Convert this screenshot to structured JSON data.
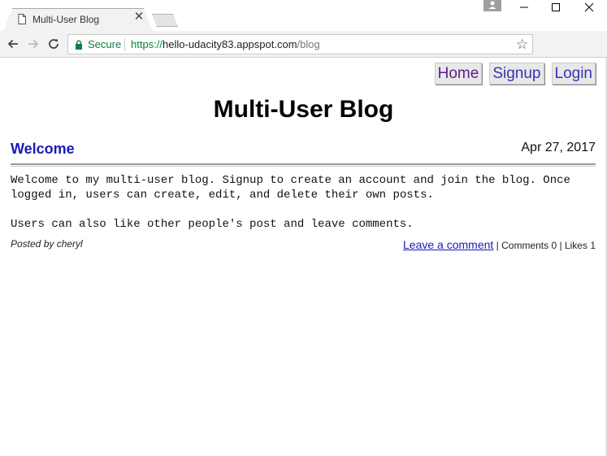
{
  "browser": {
    "tab": {
      "title": "Multi-User Blog",
      "close_glyph": "✕"
    },
    "security_label": "Secure",
    "url": {
      "scheme": "https://",
      "host": "hello-udacity83.appspot.com",
      "path": "/blog"
    },
    "icons": {
      "back": "back-arrow-icon",
      "forward": "forward-arrow-icon",
      "reload": "reload-icon",
      "lock": "lock-icon",
      "bookmark": "star-icon",
      "menu": "kebab-menu-icon"
    },
    "colors": {
      "secure": "#0b8043",
      "toolbar": "#f2f2f2"
    }
  },
  "nav": {
    "home": "Home",
    "signup": "Signup",
    "login": "Login"
  },
  "blog": {
    "title": "Multi-User Blog"
  },
  "post": {
    "subject": "Welcome",
    "date": "Apr 27, 2017",
    "body": "Welcome to my multi-user blog. Signup to create an account and join the blog. Once\nlogged in, users can create, edit, and delete their own posts.\n\nUsers can also like other people's post and leave comments.",
    "posted_by": "Posted by cheryl",
    "comment_link": "Leave a comment",
    "comments": "Comments 0",
    "likes": "Likes 1",
    "separator": "|"
  },
  "colors": {
    "link": "#1a1ab8",
    "visited_link": "#5a1f8c",
    "title": "#000000"
  }
}
